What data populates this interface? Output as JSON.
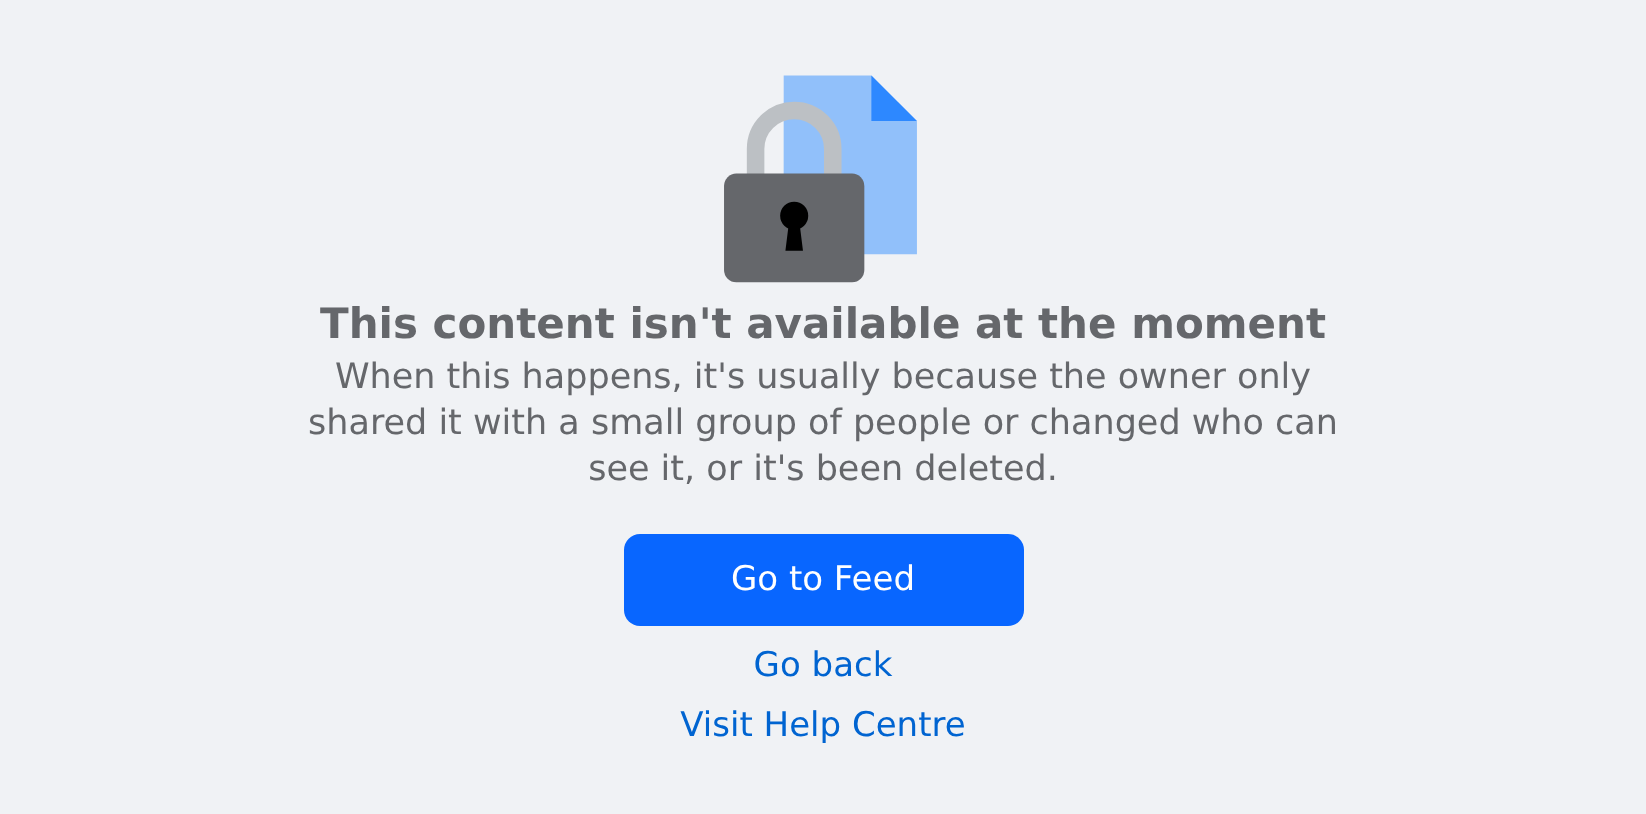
{
  "title": "This content isn't available at the moment",
  "message": "When this happens, it's usually because the owner only shared it with a small group of people or changed who can see it, or it's been deleted.",
  "primary_button": "Go to Feed",
  "links": [
    "Go back",
    "Visit Help Centre"
  ]
}
